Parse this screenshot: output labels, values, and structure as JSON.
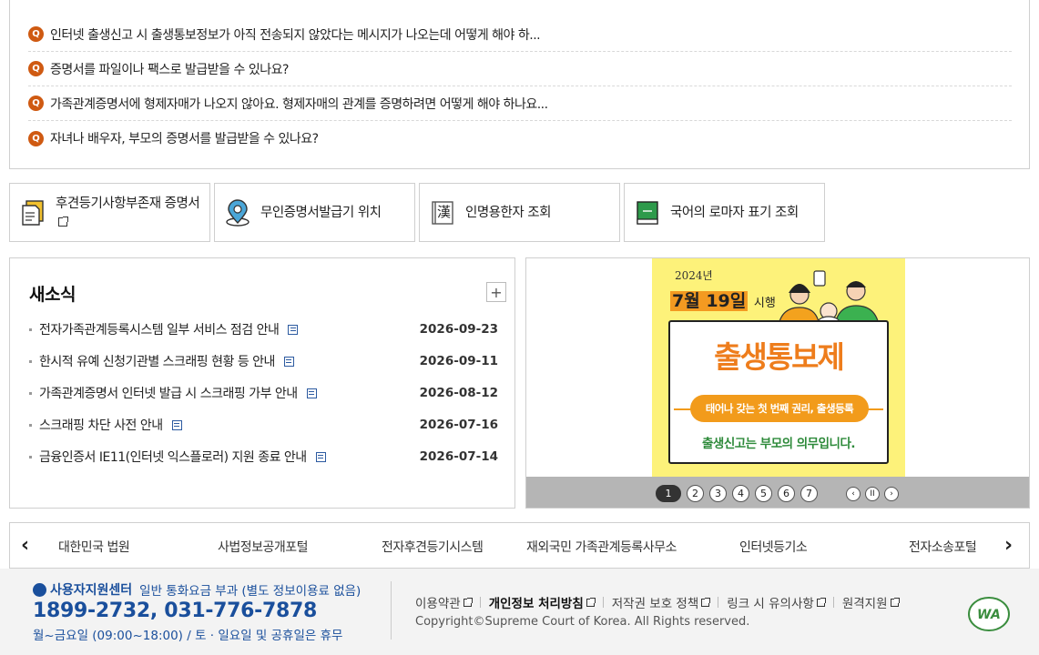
{
  "faq": {
    "items": [
      {
        "badge": "Q",
        "text": "인터넷 출생신고 시 출생통보정보가 아직 전송되지 않았다는 메시지가 나오는데 어떻게 해야 하..."
      },
      {
        "badge": "Q",
        "text": "증명서를 파일이나 팩스로 발급받을 수 있나요?"
      },
      {
        "badge": "Q",
        "text": "가족관계증명서에 형제자매가 나오지 않아요. 형제자매의 관계를 증명하려면 어떻게 해야 하나요..."
      },
      {
        "badge": "Q",
        "text": "자녀나 배우자, 부모의 증명서를 발급받을 수 있나요?"
      }
    ]
  },
  "quick_services": [
    {
      "label": "후견등기사항부존재 증명서",
      "icon": "document-certificate-icon"
    },
    {
      "label": "무인증명서발급기 위치",
      "icon": "location-pin-icon"
    },
    {
      "label": "인명용한자 조회",
      "icon": "hanja-book-icon"
    },
    {
      "label": "국어의 로마자 표기 조회",
      "icon": "green-book-icon"
    }
  ],
  "news": {
    "title": "새소식",
    "more_label": "+",
    "items": [
      {
        "title": "전자가족관계등록시스템 일부 서비스 점검 안내",
        "date": "2026-09-23"
      },
      {
        "title": "한시적 유예 신청기관별 스크래핑 현황 등 안내",
        "date": "2026-09-11"
      },
      {
        "title": "가족관계증명서 인터넷 발급 시 스크래핑 가부 안내",
        "date": "2026-08-12"
      },
      {
        "title": "스크래핑 차단 사전 안내",
        "date": "2026-07-16"
      },
      {
        "title": "금융인증서 IE11(인터넷 익스플로러) 지원 종료 안내",
        "date": "2026-07-14"
      }
    ]
  },
  "banner": {
    "year": "2024년",
    "date_highlight": "7월 19일",
    "date_suffix": "시행",
    "headline": "출생통보제",
    "pill": "태어나 갖는 첫 번째 권리, 출생등록",
    "subline": "출생신고는 부모의 의무입니다.",
    "pages": [
      "1",
      "2",
      "3",
      "4",
      "5",
      "6",
      "7"
    ],
    "active_page": "1",
    "controls": {
      "prev": "‹",
      "pause": "II",
      "next": "›"
    }
  },
  "related_sites": {
    "prev": "‹",
    "next": "›",
    "items": [
      "대한민국 법원",
      "사법정보공개포털",
      "전자후견등기시스템",
      "재외국민 가족관계등록사무소",
      "인터넷등기소",
      "전자소송포털"
    ]
  },
  "footer": {
    "center_title": "사용자지원센터",
    "center_note": "일반 통화요금 부과 (별도 정보이용료 없음)",
    "tel": "1899-2732, 031-776-7878",
    "hours": "월~금요일 (09:00~18:00) / 토 · 일요일 및 공휴일은 휴무",
    "links": [
      {
        "label": "이용약관",
        "strong": false
      },
      {
        "label": "개인정보 처리방침",
        "strong": true
      },
      {
        "label": "저작권 보호 정책",
        "strong": false
      },
      {
        "label": "링크 시 유의사항",
        "strong": false
      },
      {
        "label": "원격지원",
        "strong": false
      }
    ],
    "copyright": "Copyright©Supreme Court of Korea. All Rights reserved.",
    "badge_text": "WA"
  },
  "colors": {
    "accent_orange": "#cf5a12",
    "footer_blue": "#1a4f9c",
    "poster_yellow": "#fdf27a",
    "poster_orange": "#ee7d1c",
    "poster_green": "#2d8a3a"
  }
}
